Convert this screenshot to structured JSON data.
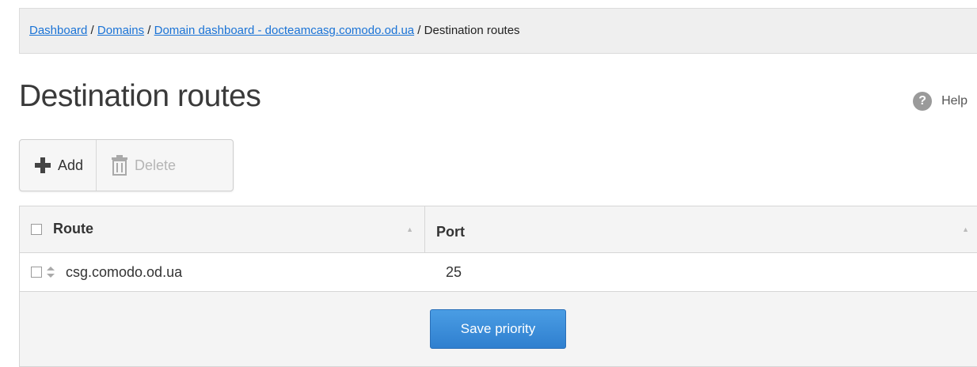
{
  "breadcrumb": {
    "items": [
      "Dashboard",
      "Domains",
      "Domain dashboard - docteamcasg.comodo.od.ua"
    ],
    "separator": " / ",
    "current": "Destination routes"
  },
  "page": {
    "title": "Destination routes"
  },
  "help": {
    "label": "Help",
    "icon": "question-icon",
    "glyph": "?"
  },
  "toolbar": {
    "add_label": "Add",
    "add_icon": "plus-icon",
    "delete_label": "Delete",
    "delete_icon": "trash-icon"
  },
  "table": {
    "columns": [
      "Route",
      "Port"
    ],
    "rows": [
      {
        "route": "csg.comodo.od.ua",
        "port": "25"
      }
    ]
  },
  "footer": {
    "save_label": "Save priority"
  },
  "colors": {
    "link": "#1a73d6",
    "primary_button": "#3a8ad9",
    "header_bg": "#f4f4f4"
  }
}
